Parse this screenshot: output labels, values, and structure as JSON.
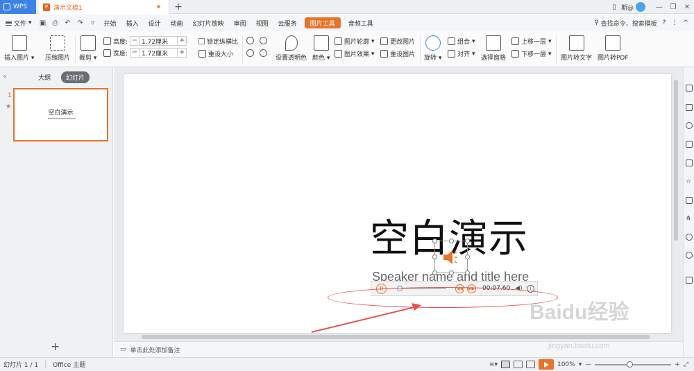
{
  "titlebar": {
    "app_tab": "WPS",
    "doc_tab": "演示文稿1",
    "doc_icon": "P",
    "new_tab": "+",
    "user_name": "斯@"
  },
  "menubar": {
    "file": "文件",
    "tabs": [
      "开始",
      "插入",
      "设计",
      "动画",
      "幻灯片放映",
      "审阅",
      "视图",
      "云服务",
      "图片工具",
      "音频工具"
    ],
    "active_tab": "图片工具",
    "search": "查找命令、搜索模板",
    "help": "?",
    "more": "⋮",
    "collapse": "^"
  },
  "ribbon": {
    "insert_picture": "插入图片",
    "compress_picture": "压缩图片",
    "crop": "裁剪",
    "height_label": "高度:",
    "height_value": "1.72厘米",
    "width_label": "宽度:",
    "width_value": "1.72厘米",
    "lock_ratio": "锁定纵横比",
    "reset_size": "重设大小",
    "set_transparent": "设置透明色",
    "color": "颜色",
    "picture_outline": "图片轮廓",
    "picture_effect": "图片效果",
    "change_picture": "更改图片",
    "reset_picture": "重设图片",
    "rotate": "旋转",
    "group": "组合",
    "align": "对齐",
    "selection_pane": "选择窗格",
    "bring_forward": "上移一层",
    "send_backward": "下移一层",
    "pic_to_text": "图片转文字",
    "pic_to_pdf": "图片转PDF"
  },
  "leftpanel": {
    "tab_outline": "大纲",
    "tab_slides": "幻灯片",
    "slide_number": "1",
    "thumb_title": "空白演示",
    "add": "+"
  },
  "slide": {
    "title": "空白演示",
    "subtitle": "Speaker name and title here"
  },
  "player": {
    "time": "00:07.60"
  },
  "notes": {
    "placeholder": "单击此处添加备注"
  },
  "statusbar": {
    "slide_info": "幻灯片 1 / 1",
    "theme": "Office 主题",
    "zoom": "100%",
    "zoom_level": 0.45
  },
  "watermark": {
    "brand": "Baidu经验",
    "url": "jingyan.baidu.com"
  },
  "colors": {
    "accent": "#e8742a",
    "wps_blue": "#3c82e6",
    "annotation_red": "#e5534f"
  }
}
